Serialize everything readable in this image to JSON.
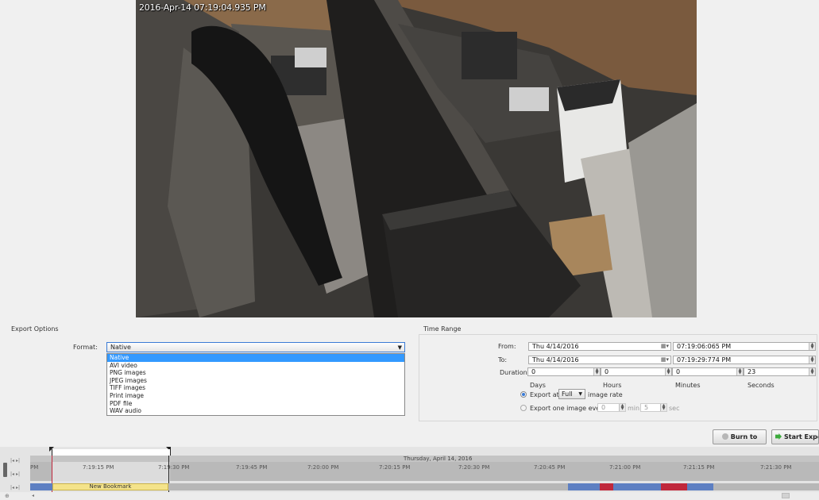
{
  "camera": {
    "timestamp": "2016-Apr-14 07:19:04.935 PM"
  },
  "export_options": {
    "title": "Export Options",
    "format_label": "Format:",
    "format_value": "Native",
    "format_options": [
      "Native",
      "AVI video",
      "PNG images",
      "JPEG images",
      "TIFF images",
      "Print image",
      "PDF file",
      "WAV audio"
    ]
  },
  "time_range": {
    "title": "Time Range",
    "from_label": "From:",
    "from_date": "Thu  4/14/2016",
    "from_time": "07:19:06:065  PM",
    "to_label": "To:",
    "to_date": "Thu  4/14/2016",
    "to_time": "07:19:29:774  PM",
    "duration_label": "Duration:",
    "days": "0",
    "hours": "0",
    "minutes": "0",
    "seconds": "23",
    "days_label": "Days",
    "hours_label": "Hours",
    "minutes_label": "Minutes",
    "seconds_label": "Seconds",
    "export_at_label": "Export at",
    "rate_value": "Full",
    "rate_suffix": "image rate",
    "export_one_label": "Export one image every",
    "every_min": "0",
    "min_label": "min.",
    "every_sec": "5",
    "sec_label": "sec"
  },
  "buttons": {
    "burn": "Burn to Disc",
    "start": "Start Export"
  },
  "timeline": {
    "date": "Thursday, April 14, 2016",
    "ticks": [
      "PM",
      "7:19:15 PM",
      "7:19:30 PM",
      "7:19:45 PM",
      "7:20:00 PM",
      "7:20:15 PM",
      "7:20:30 PM",
      "7:20:45 PM",
      "7:21:00 PM",
      "7:21:15 PM",
      "7:21:30 PM"
    ],
    "bookmark": "New Bookmark",
    "drag_handle": "ooooo"
  },
  "colors": {
    "selection": "#3399ff",
    "bookmark": "#f4e38a",
    "recording": "#5d7fc2",
    "motion": "#c0283c"
  }
}
